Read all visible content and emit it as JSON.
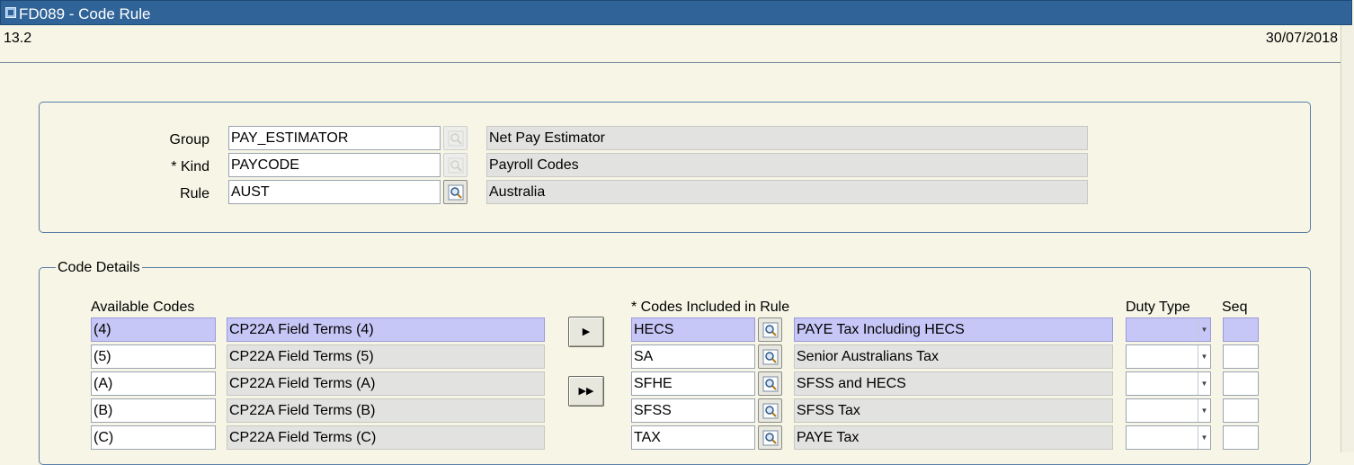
{
  "window": {
    "title": "FD089 - Code Rule",
    "version": "13.2",
    "date": "30/07/2018"
  },
  "header_form": {
    "group": {
      "label": "Group",
      "value": "PAY_ESTIMATOR",
      "description": "Net Pay Estimator"
    },
    "kind": {
      "label": "* Kind",
      "value": "PAYCODE",
      "description": "Payroll Codes"
    },
    "rule": {
      "label": "Rule",
      "value": "AUST",
      "description": "Australia"
    }
  },
  "code_details": {
    "legend": "Code Details",
    "available_header": "Available Codes",
    "included_header": "* Codes Included in Rule",
    "duty_type_header": "Duty Type",
    "seq_header": "Seq",
    "available": [
      {
        "code": "(4)",
        "description": "CP22A Field Terms (4)"
      },
      {
        "code": "(5)",
        "description": "CP22A Field Terms (5)"
      },
      {
        "code": "(A)",
        "description": "CP22A Field Terms (A)"
      },
      {
        "code": "(B)",
        "description": "CP22A Field Terms (B)"
      },
      {
        "code": "(C)",
        "description": "CP22A Field Terms (C)"
      }
    ],
    "included": [
      {
        "code": "HECS",
        "description": "PAYE Tax Including HECS"
      },
      {
        "code": "SA",
        "description": "Senior Australians Tax"
      },
      {
        "code": "SFHE",
        "description": "SFSS and HECS"
      },
      {
        "code": "SFSS",
        "description": "SFSS Tax"
      },
      {
        "code": "TAX",
        "description": "PAYE Tax"
      }
    ],
    "buttons": {
      "add_one": "▶",
      "add_all": "▶▶"
    }
  },
  "colors": {
    "titlebar": "#306498",
    "background": "#f6f5e6",
    "selected_row": "#c7c7f7",
    "readonly_field": "#e2e2e0"
  },
  "icons": {
    "lov": "magnifier-icon",
    "dropdown": "chevron-down-icon"
  }
}
